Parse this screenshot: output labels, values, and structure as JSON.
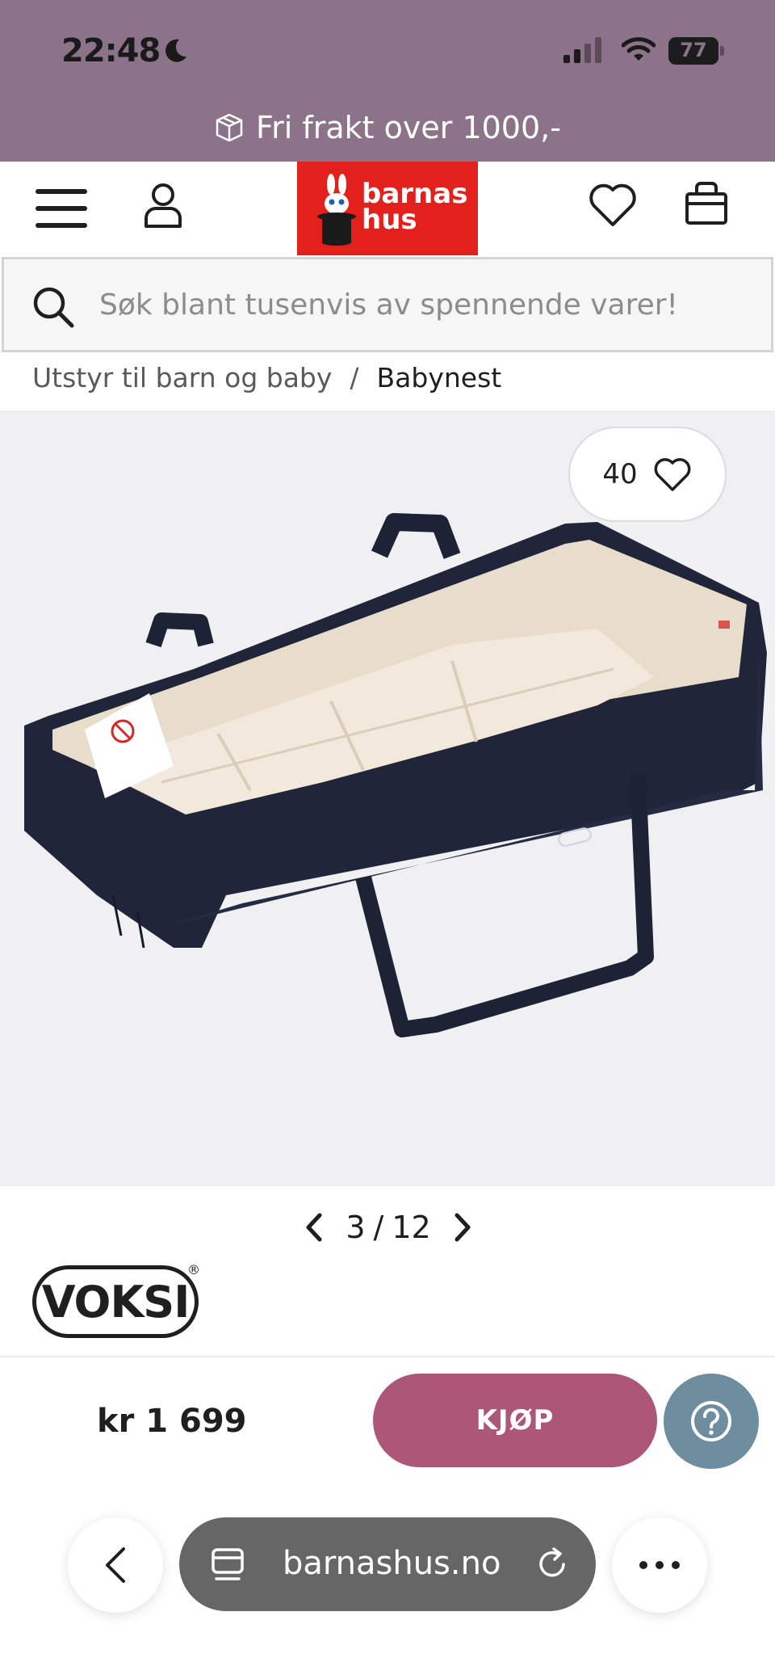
{
  "status_bar": {
    "time": "22:48",
    "battery": "77"
  },
  "promo": {
    "text": "Fri frakt over 1000,-"
  },
  "header": {
    "logo_line1": "barnas",
    "logo_line2": "hus"
  },
  "search": {
    "placeholder": "Søk blant tusenvis av spennende varer!"
  },
  "breadcrumb": {
    "items": [
      "Utstyr til barn og baby",
      "Babynest"
    ],
    "separator": "/"
  },
  "product": {
    "favorites_count": "40",
    "image_index": "3",
    "image_sep": "/",
    "image_total": "12",
    "brand": "VOKSI",
    "brand_mark": "®",
    "price": "kr 1 699",
    "label_text": "VOKSI"
  },
  "actions": {
    "buy_label": "KJØP"
  },
  "browser": {
    "url": "barnashus.no"
  },
  "colors": {
    "top_band": "#8c7389",
    "logo_red": "#e3201b",
    "buy_button": "#ad5677",
    "help_button": "#6e8ea0",
    "url_pill": "#666666"
  }
}
